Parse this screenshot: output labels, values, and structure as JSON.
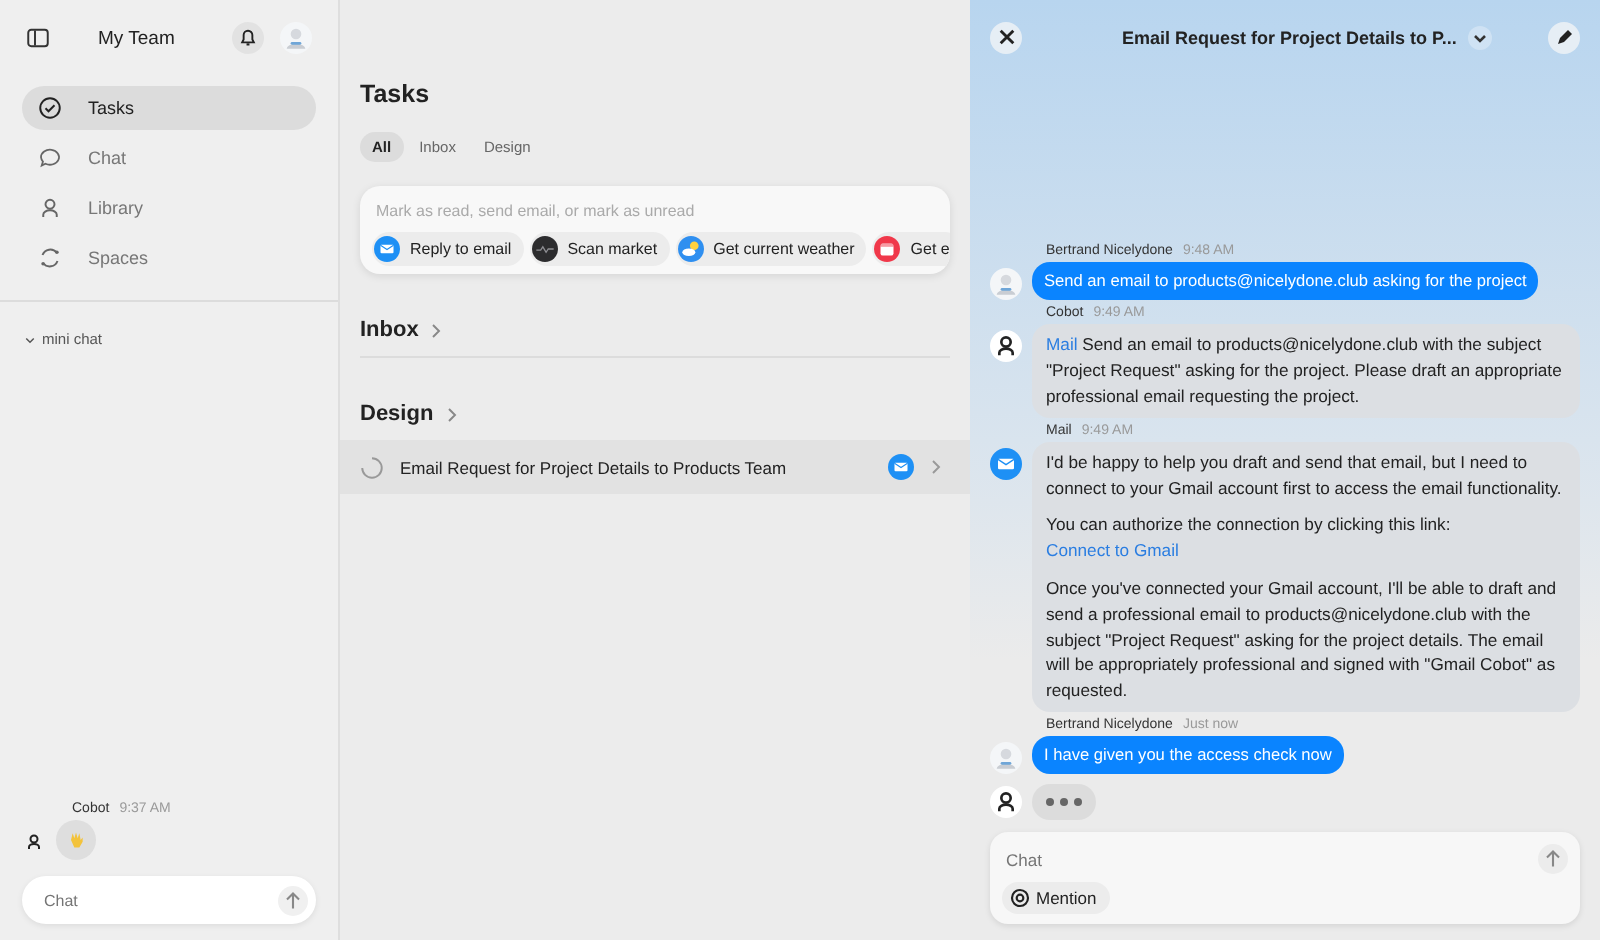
{
  "sidebar": {
    "team": "My Team",
    "nav": [
      {
        "label": "Tasks",
        "selected": true
      },
      {
        "label": "Chat",
        "selected": false
      },
      {
        "label": "Library",
        "selected": false
      },
      {
        "label": "Spaces",
        "selected": false
      }
    ],
    "mini_chat": {
      "label": "mini chat",
      "expanded": true,
      "author": "Cobot",
      "time": "9:37 AM",
      "placeholder": "Chat"
    }
  },
  "tasks": {
    "title": "Tasks",
    "tabs": [
      {
        "label": "All",
        "selected": true
      },
      {
        "label": "Inbox",
        "selected": false
      },
      {
        "label": "Design",
        "selected": false
      }
    ],
    "command": {
      "placeholder": "Mark as read, send email, or mark as unread",
      "chips": [
        {
          "label": "Reply to email",
          "kind": "mail"
        },
        {
          "label": "Scan market",
          "kind": "market"
        },
        {
          "label": "Get current weather",
          "kind": "weather"
        },
        {
          "label": "Get e",
          "kind": "calendar"
        }
      ]
    },
    "sections": [
      {
        "title": "Inbox"
      },
      {
        "title": "Design",
        "items": [
          {
            "title": "Email Request for Project Details to Products Team"
          }
        ]
      }
    ]
  },
  "chat": {
    "title": "Email Request for Project Details to P...",
    "messages": [
      {
        "author": "Bertrand Nicelydone",
        "time": "9:48 AM",
        "kind": "user",
        "paragraphs": [
          [
            {
              "text": "Send an email to products@nicelydone.club asking for the project"
            }
          ]
        ]
      },
      {
        "author": "Cobot",
        "time": "9:49 AM",
        "kind": "bot",
        "paragraphs": [
          [
            {
              "text": "Mail",
              "link": true
            },
            {
              "text": " Send an email to products@nicelydone.club with the subject \"Project Request\" asking for the project. Please draft an appropriate professional email requesting the project."
            }
          ]
        ]
      },
      {
        "author": "Mail",
        "time": "9:49 AM",
        "kind": "mail",
        "paragraphs": [
          [
            {
              "text": "I'd be happy to help you draft and send that email, but I need to connect to your Gmail account first to access the email functionality."
            }
          ],
          [
            {
              "text": "You can authorize the connection by clicking this link: "
            },
            {
              "text": "Connect to Gmail",
              "link": true
            }
          ],
          [
            {
              "text": "Once you've connected your Gmail account, I'll be able to draft and send a professional email to products@nicelydone.club with the subject \"Project Request\" asking for the project details. The email will be appropriately professional and signed with \"Gmail Cobot\" as requested."
            }
          ]
        ]
      },
      {
        "author": "Bertrand Nicelydone",
        "time": "Just now",
        "kind": "user",
        "paragraphs": [
          [
            {
              "text": "I have given you the access check now"
            }
          ]
        ]
      },
      {
        "kind": "typing"
      }
    ],
    "composer": {
      "placeholder": "Chat",
      "mention": "Mention"
    }
  }
}
